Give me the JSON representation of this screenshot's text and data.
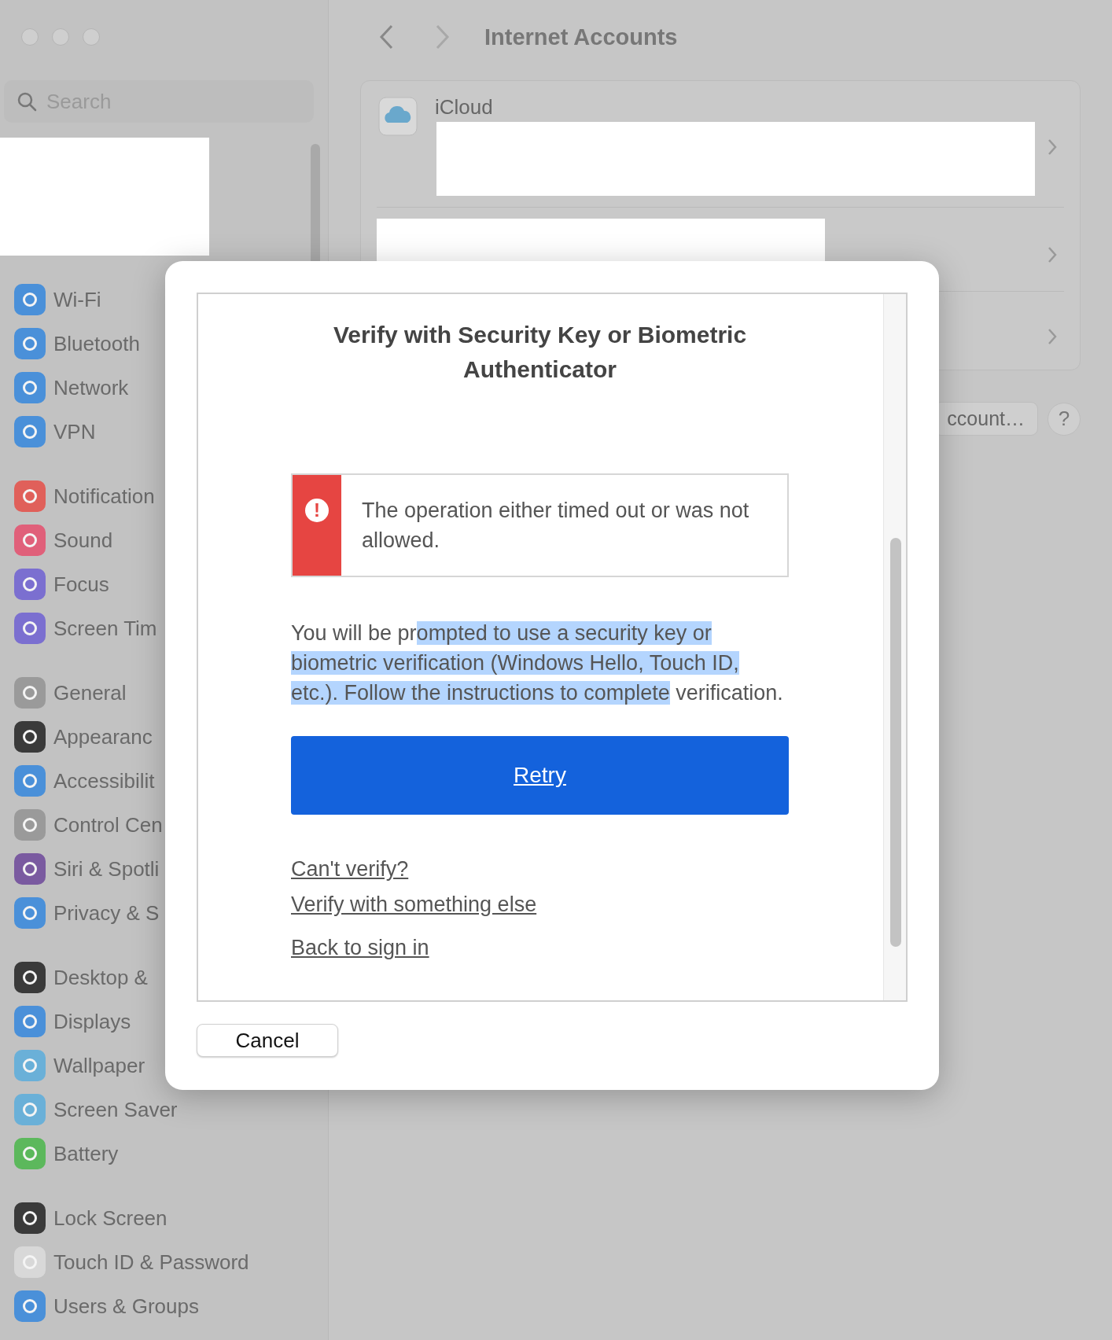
{
  "window": {
    "title": "Internet Accounts",
    "search": {
      "placeholder": "Search"
    }
  },
  "sidebar": {
    "groups": [
      [
        {
          "label": "Wi-Fi",
          "color": "#4a90d9"
        },
        {
          "label": "Bluetooth",
          "color": "#4a90d9"
        },
        {
          "label": "Network",
          "color": "#4a90d9"
        },
        {
          "label": "VPN",
          "color": "#4a90d9"
        }
      ],
      [
        {
          "label": "Notification",
          "color": "#e0605a"
        },
        {
          "label": "Sound",
          "color": "#e0607a"
        },
        {
          "label": "Focus",
          "color": "#7b6fd0"
        },
        {
          "label": "Screen Tim",
          "color": "#7b6fd0"
        }
      ],
      [
        {
          "label": "General",
          "color": "#9a9a9a"
        },
        {
          "label": "Appearanc",
          "color": "#3a3a3a"
        },
        {
          "label": "Accessibilit",
          "color": "#4a90d9"
        },
        {
          "label": "Control Cen",
          "color": "#9a9a9a"
        },
        {
          "label": "Siri & Spotli",
          "color": "#7a5aa0"
        },
        {
          "label": "Privacy & S",
          "color": "#4a90d9"
        }
      ],
      [
        {
          "label": "Desktop & ",
          "color": "#3a3a3a"
        },
        {
          "label": "Displays",
          "color": "#4a90d9"
        },
        {
          "label": "Wallpaper",
          "color": "#6ab0d8"
        },
        {
          "label": "Screen Saver",
          "color": "#6ab0d8"
        },
        {
          "label": "Battery",
          "color": "#5cb85c"
        }
      ],
      [
        {
          "label": "Lock Screen",
          "color": "#3a3a3a"
        },
        {
          "label": "Touch ID & Password",
          "color": "#d8d8d8"
        },
        {
          "label": "Users & Groups",
          "color": "#4a90d9"
        }
      ]
    ]
  },
  "accounts": [
    {
      "name": "iCloud"
    }
  ],
  "add_account_button": "ccount…",
  "help_button": "?",
  "dialog": {
    "title": "Verify with Security Key or Biometric Authenticator",
    "error": {
      "icon": "!",
      "message": "The operation either timed out or was not allowed."
    },
    "instructions": {
      "before": "You will be pr",
      "selected": "ompted to use a security key or biometric verification (Windows Hello, Touch ID, etc.). Follow the instructions to complete",
      "after": " verification."
    },
    "primary_button": "Retry",
    "links": [
      "Can't verify?",
      "Verify with something else",
      "Back to sign in"
    ],
    "cancel_button": "Cancel"
  }
}
